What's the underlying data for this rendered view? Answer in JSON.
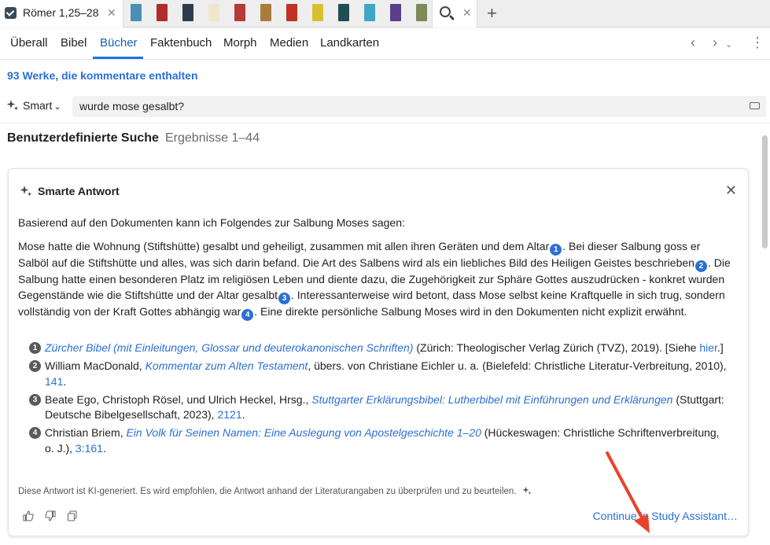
{
  "tabs": {
    "active_title": "Römer 1,25–28",
    "close_glyph": "✕",
    "book_colors": [
      "#4a8fb8",
      "#b32c2c",
      "#2d3c4a",
      "#f0e6cf",
      "#b63a3a",
      "#a97c3b",
      "#c23021",
      "#d7c130",
      "#1f4e54",
      "#3fa6c7",
      "#5b3e8c",
      "#7e8a5a"
    ],
    "new_tab_glyph": "+"
  },
  "nav": {
    "tabs": [
      "Überall",
      "Bibel",
      "Bücher",
      "Faktenbuch",
      "Morph",
      "Medien",
      "Landkarten"
    ],
    "active": "Bücher",
    "back_glyph": "‹",
    "forward_glyph": "›",
    "more_glyph": "⋮"
  },
  "works_link": "93 Werke, die kommentare enthalten",
  "search": {
    "mode_label": "Smart",
    "query": "wurde mose gesalbt?"
  },
  "results": {
    "title": "Benutzerdefinierte Suche",
    "range": "Ergebnisse 1–44"
  },
  "answer": {
    "heading": "Smarte Antwort",
    "intro": "Basierend auf den Dokumenten kann ich Folgendes zur Salbung Moses sagen:",
    "body": [
      {
        "text": "Mose hatte die Wohnung (Stiftshütte) gesalbt und geheiligt, zusammen mit allen ihren Geräten und dem Altar",
        "cite": "1"
      },
      {
        "text": ". Bei dieser Salbung goss er Salböl auf die Stiftshütte und alles, was sich darin befand. Die Art des Salbens wird als ein liebliches Bild des Heiligen Geistes beschrieben",
        "cite": "2"
      },
      {
        "text": ". Die Salbung hatte einen besonderen Platz im religiösen Leben und diente dazu, die Zugehörigkeit zur Sphäre Gottes auszudrücken - konkret wurden Gegenstände wie die Stiftshütte und der Altar gesalbt",
        "cite": "3"
      },
      {
        "text": ". Interessanterweise wird betont, dass Mose selbst keine Kraftquelle in sich trug, sondern vollständig von der Kraft Gottes abhängig war",
        "cite": "4"
      },
      {
        "text": ". Eine direkte persönliche Salbung Moses wird in den Dokumenten nicht explizit erwähnt.",
        "cite": ""
      }
    ],
    "references": [
      {
        "num": "1",
        "pre": "",
        "title": "Zürcher Bibel (mit Einleitungen, Glossar und deuterokanonischen Schriften)",
        "post": " (Zürich: Theologischer Verlag Zürich (TVZ), 2019). [Siehe ",
        "link": "hier",
        "tail": ".]"
      },
      {
        "num": "2",
        "pre": "William MacDonald, ",
        "title": "Kommentar zum Alten Testament",
        "post": ", übers. von Christiane Eichler u. a. (Bielefeld: Christliche Literatur-Verbreitung, 2010), ",
        "link": "141",
        "tail": "."
      },
      {
        "num": "3",
        "pre": "Beate Ego, Christoph Rösel, und Ulrich Heckel, Hrsg., ",
        "title": "Stuttgarter Erklärungsbibel: Lutherbibel mit Einführungen und Erklärungen",
        "post": " (Stuttgart: Deutsche Bibelgesellschaft, 2023), ",
        "link": "2121",
        "tail": "."
      },
      {
        "num": "4",
        "pre": "Christian Briem, ",
        "title": "Ein Volk für Seinen Namen: Eine Auslegung von Apostelgeschichte 1–20",
        "post": " (Hückeswagen: Christliche Schriftenverbreitung, o. J.), ",
        "link": "3:161",
        "tail": "."
      }
    ],
    "disclaimer": "Diese Antwort ist KI-generiert. Es wird empfohlen, die Antwort anhand der Literaturangaben zu überprüfen und zu beurteilen.",
    "continue_label": "Continue in Study Assistant…"
  },
  "colors": {
    "accent": "#2b6fd6",
    "arrow": "#e8432a"
  }
}
